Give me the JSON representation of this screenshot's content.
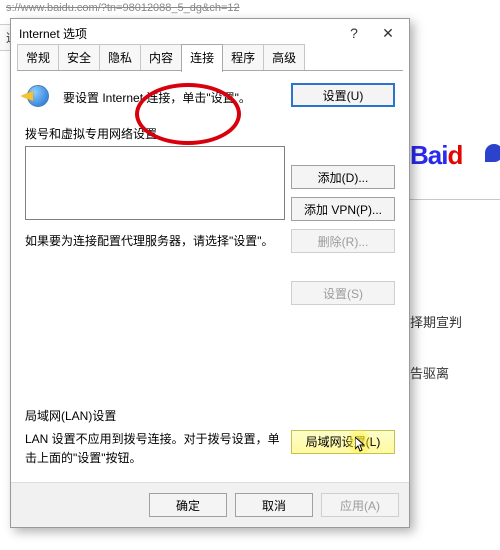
{
  "browser": {
    "url": "s://www.baidu.com/?tn=98012088_5_dg&ch=12",
    "bg_tab": "道",
    "logo_pre": "Bai",
    "logo_red": "d",
    "bg_line1": "择期宣判",
    "bg_line2": "告驱离"
  },
  "dialog": {
    "title": "Internet 选项",
    "help_glyph": "?",
    "close_glyph": "✕",
    "tabs": [
      "常规",
      "安全",
      "隐私",
      "内容",
      "连接",
      "程序",
      "高级"
    ],
    "active_tab_index": 4,
    "connect_desc": "要设置 Internet 连接，单击\"设置\"。",
    "btn_setup": "设置(U)",
    "section_dial": "拨号和虚拟专用网络设置",
    "btn_add": "添加(D)...",
    "btn_add_vpn": "添加 VPN(P)...",
    "btn_remove": "删除(R)...",
    "btn_settings": "设置(S)",
    "proxy_desc": "如果要为连接配置代理服务器，请选择\"设置\"。",
    "lan_title": "局域网(LAN)设置",
    "lan_desc": "LAN 设置不应用到拨号连接。对于拨号设置，单击上面的\"设置\"按钮。",
    "btn_lan": "局域网设置(L)",
    "btn_ok": "确定",
    "btn_cancel": "取消",
    "btn_apply": "应用(A)"
  }
}
